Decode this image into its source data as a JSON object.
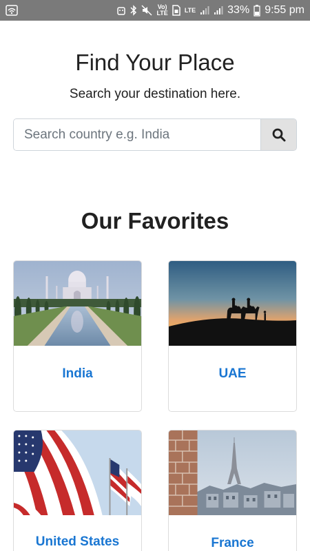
{
  "status_bar": {
    "volte_label": "Vo)\nLTE",
    "lte_label": "LTE",
    "battery_percent": "33%",
    "time": "9:55 pm"
  },
  "hero": {
    "title": "Find Your Place",
    "subtitle": "Search your destination here."
  },
  "search": {
    "placeholder": "Search country e.g. India",
    "value": ""
  },
  "favorites": {
    "title": "Our Favorites",
    "items": [
      {
        "label": "India",
        "icon": "taj-mahal-image"
      },
      {
        "label": "UAE",
        "icon": "desert-camels-image"
      },
      {
        "label": "United States",
        "icon": "us-flags-image"
      },
      {
        "label": "France",
        "icon": "paris-eiffel-image"
      }
    ]
  },
  "colors": {
    "status_bar": "#7a7a7a",
    "link": "#1976d2",
    "search_button": "#e2e2e2"
  }
}
